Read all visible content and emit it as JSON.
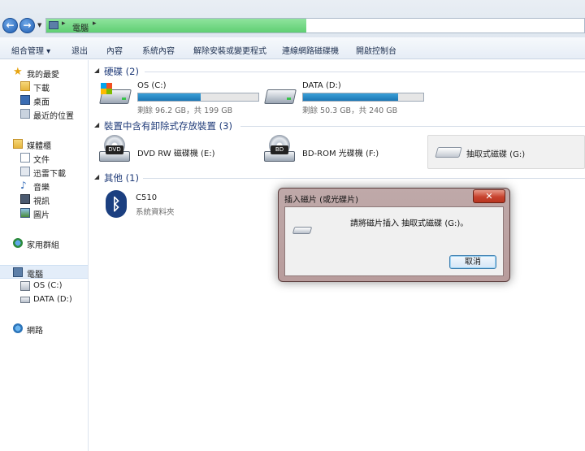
{
  "address": {
    "crumbs": [
      "電腦"
    ]
  },
  "toolbar": {
    "organize": "組合管理 ▾",
    "eject": "退出",
    "properties": "內容",
    "system_properties": "系統內容",
    "uninstall": "解除安裝或變更程式",
    "map_drive": "連線網路磁碟機",
    "control_panel": "開啟控制台"
  },
  "sidebar": {
    "favorites": "我的最愛",
    "downloads": "下載",
    "desktop": "桌面",
    "recent": "最近的位置",
    "libraries": "媒體櫃",
    "documents": "文件",
    "thunder": "迅雷下載",
    "music": "音樂",
    "videos": "視訊",
    "pictures": "圖片",
    "homegroup": "家用群組",
    "computer": "電腦",
    "drive_c": "OS (C:)",
    "drive_d": "DATA (D:)",
    "network": "網路"
  },
  "groups": {
    "hdd": "硬碟 (2)",
    "removable": "裝置中含有卸除式存放裝置 (3)",
    "other": "其他 (1)"
  },
  "drives": {
    "c": {
      "name": "OS (C:)",
      "free": "剩餘 96.2 GB，共 199 GB",
      "used_fraction": 0.52
    },
    "d": {
      "name": "DATA (D:)",
      "free": "剩餘 50.3 GB，共 240 GB",
      "used_fraction": 0.79
    },
    "e": {
      "name": "DVD RW 磁碟機 (E:)",
      "badge": "DVD"
    },
    "f": {
      "name": "BD-ROM 光碟機 (F:)",
      "badge": "BD"
    },
    "g": {
      "name": "抽取式磁碟 (G:)"
    }
  },
  "other_item": {
    "name": "C510",
    "type": "系統資料夾"
  },
  "dialog": {
    "title": "插入磁片 (或光碟片)",
    "close": "✕",
    "message": "請將磁片插入 抽取式磁碟 (G:)。",
    "cancel": "取消"
  },
  "colors": {
    "bar_fill": "#1c76b4",
    "progress": "#5fcf73",
    "dialog_frame": "#b89c9c"
  }
}
